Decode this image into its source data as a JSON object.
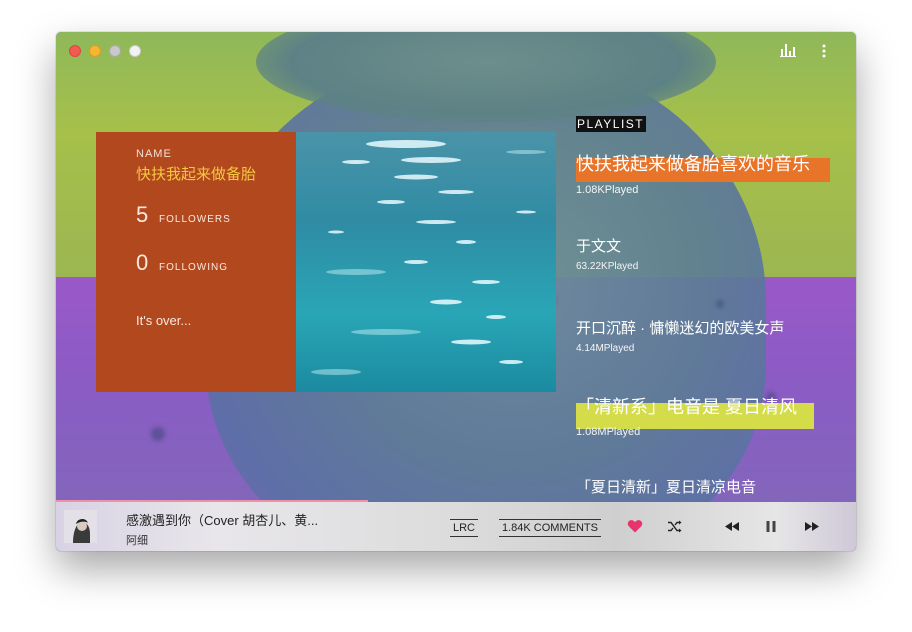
{
  "window": {
    "controls": [
      "close",
      "minimize",
      "disabled",
      "fullscreen"
    ]
  },
  "toolbar": {
    "icons": [
      "equalizer-icon",
      "more-vertical-icon"
    ]
  },
  "profile": {
    "name_label": "NAME",
    "name": "快扶我起来做备胎",
    "followers_count": "5",
    "followers_label": "FOLLOWERS",
    "following_count": "0",
    "following_label": "FOLLOWING",
    "signature": "It's over..."
  },
  "playlist": {
    "header": "PLAYLIST",
    "items": [
      {
        "title": "快扶我起来做备胎喜欢的音乐",
        "plays": "1.08KPlayed",
        "highlight": "#e8742a"
      },
      {
        "title": "于文文",
        "plays": "63.22KPlayed",
        "highlight": ""
      },
      {
        "title": "开口沉醉 · 慵懒迷幻的欧美女声",
        "plays": "4.14MPlayed",
        "highlight": ""
      },
      {
        "title": "「清新系」电音是 夏日清风",
        "plays": "1.08MPlayed",
        "highlight": "#d4dc4a"
      },
      {
        "title": "「夏日清新」夏日清凉电音",
        "plays": "",
        "highlight": ""
      }
    ]
  },
  "player": {
    "song_title": "感激遇到你（Cover 胡杏儿、黄...",
    "artist": "阿细",
    "lrc_label": "LRC",
    "comments_label": "1.84K COMMENTS",
    "progress": 0.39,
    "liked": true,
    "accent": "#e8336d",
    "icons": [
      "heart-icon",
      "shuffle-icon",
      "previous-icon",
      "pause-icon",
      "next-icon"
    ]
  }
}
